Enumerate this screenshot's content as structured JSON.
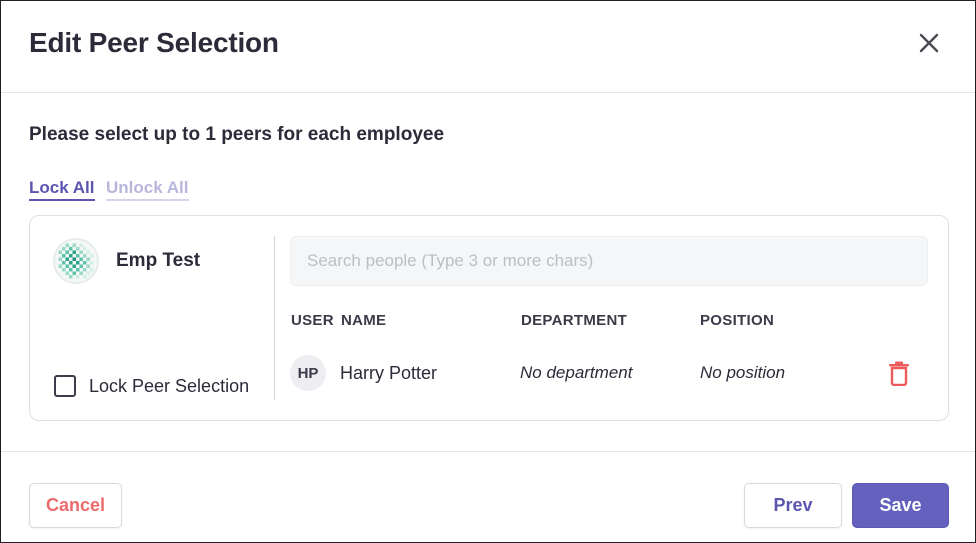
{
  "dialog": {
    "title": "Edit Peer Selection",
    "instruction": "Please select up to 1 peers for each employee"
  },
  "bulk_actions": {
    "lock_all": "Lock All",
    "unlock_all": "Unlock All"
  },
  "employee": {
    "name": "Emp Test",
    "lock_label": "Lock Peer Selection",
    "lock_checked": false,
    "avatar_icon": "globe-pattern-avatar"
  },
  "search": {
    "placeholder": "Search people (Type 3 or more chars)",
    "value": ""
  },
  "table": {
    "columns": [
      "USER",
      "NAME",
      "DEPARTMENT",
      "POSITION"
    ],
    "rows": [
      {
        "initials": "HP",
        "name": "Harry Potter",
        "department": "No department",
        "position": "No position"
      }
    ]
  },
  "footer": {
    "cancel": "Cancel",
    "prev": "Prev",
    "save": "Save"
  },
  "colors": {
    "accent": "#6460bd",
    "link": "#5c55b0",
    "link_disabled": "#b9b6dc",
    "danger": "#ec6b6b",
    "text": "#2b2b3a"
  }
}
